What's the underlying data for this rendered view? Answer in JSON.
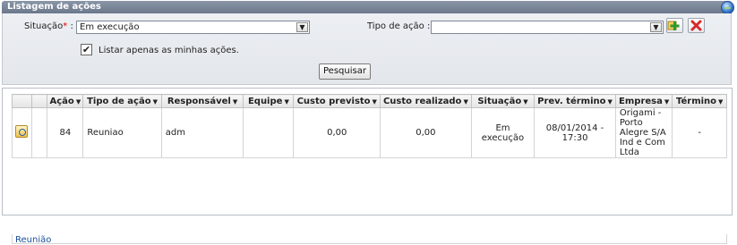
{
  "window": {
    "title": "Listagem de ações"
  },
  "filters": {
    "situacao_label": "Situação",
    "required_mark": "*",
    "situacao_colon": ":",
    "situacao_value": "Em execução",
    "tipo_acao_label": "Tipo de ação :",
    "tipo_acao_value": "",
    "only_mine_label": "Listar apenas as minhas ações.",
    "only_mine_checked": "✔",
    "search_button": "Pesquisar"
  },
  "grid": {
    "columns": [
      "",
      "Ação",
      "Tipo de ação",
      "Responsável",
      "Equipe",
      "Custo previsto",
      "Custo realizado",
      "Situação",
      "Prev. término",
      "Empresa",
      "Término"
    ],
    "rows": [
      {
        "acao": "84",
        "tipo": "Reuniao",
        "responsavel": "adm",
        "equipe": "",
        "custo_previsto": "0,00",
        "custo_realizado": "0,00",
        "situacao": "Em execução",
        "prev_termino": "08/01/2014 - 17:30",
        "empresa": "Origami - Porto Alegre S/A Ind e Com Ltda",
        "termino": "-"
      }
    ],
    "group_link": "Reunião"
  },
  "icons": {
    "globe": "globe-icon",
    "add": "add-icon",
    "remove": "remove-icon",
    "row": "action-icon",
    "sort": "sort-down-icon"
  },
  "colors": {
    "titlebar": "#6b778b",
    "panel": "#e6e9ed",
    "link": "#1a4f99",
    "add_green": "#2e9b2e",
    "remove_red": "#d42a2a"
  }
}
